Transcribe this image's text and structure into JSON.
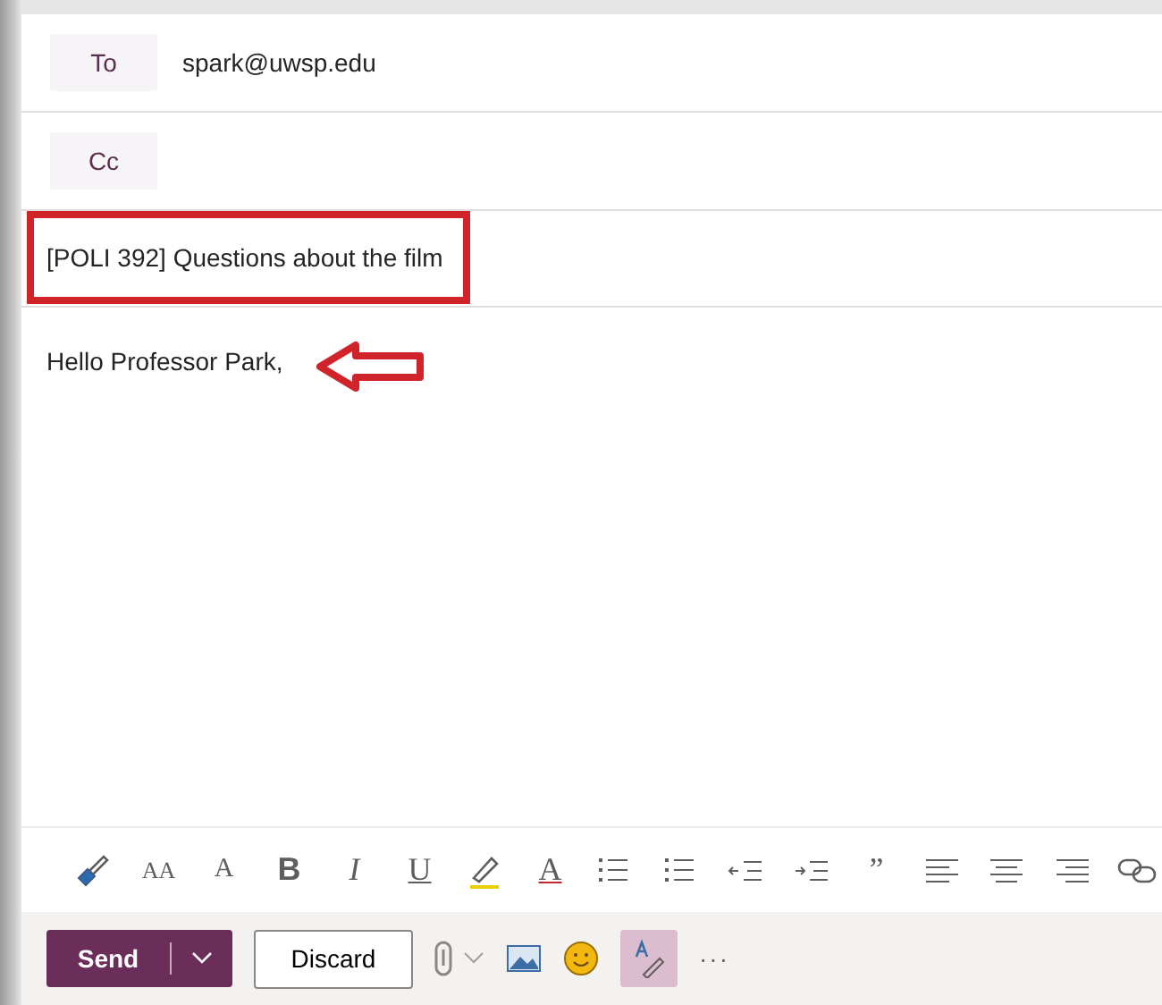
{
  "recipients": [
    {
      "label": "To",
      "value": "spark@uwsp.edu"
    },
    {
      "label": "Cc"
    }
  ],
  "subject": {
    "value": "[POLI 392] Questions about the film",
    "highlighted": true
  },
  "body": {
    "text": "Hello Professor Park,",
    "arrow": true
  },
  "format_toolbar": [
    {
      "kind": "brush"
    },
    {
      "kind": "font-size",
      "text": "AA"
    },
    {
      "kind": "grow",
      "text": "A"
    },
    {
      "kind": "bold",
      "text": "B"
    },
    {
      "kind": "italic",
      "text": "I"
    },
    {
      "kind": "underline",
      "text": "U"
    },
    {
      "kind": "highlight"
    },
    {
      "kind": "font-color",
      "text": "A"
    },
    {
      "kind": "bullets"
    },
    {
      "kind": "numbering"
    },
    {
      "kind": "outdent"
    },
    {
      "kind": "indent"
    },
    {
      "kind": "quote",
      "text": "”"
    },
    {
      "kind": "align-left"
    },
    {
      "kind": "align-center"
    },
    {
      "kind": "align-right"
    },
    {
      "kind": "link"
    }
  ],
  "actions": {
    "send": "Send",
    "discard": "Discard",
    "more": "···",
    "editor_selected": true
  }
}
